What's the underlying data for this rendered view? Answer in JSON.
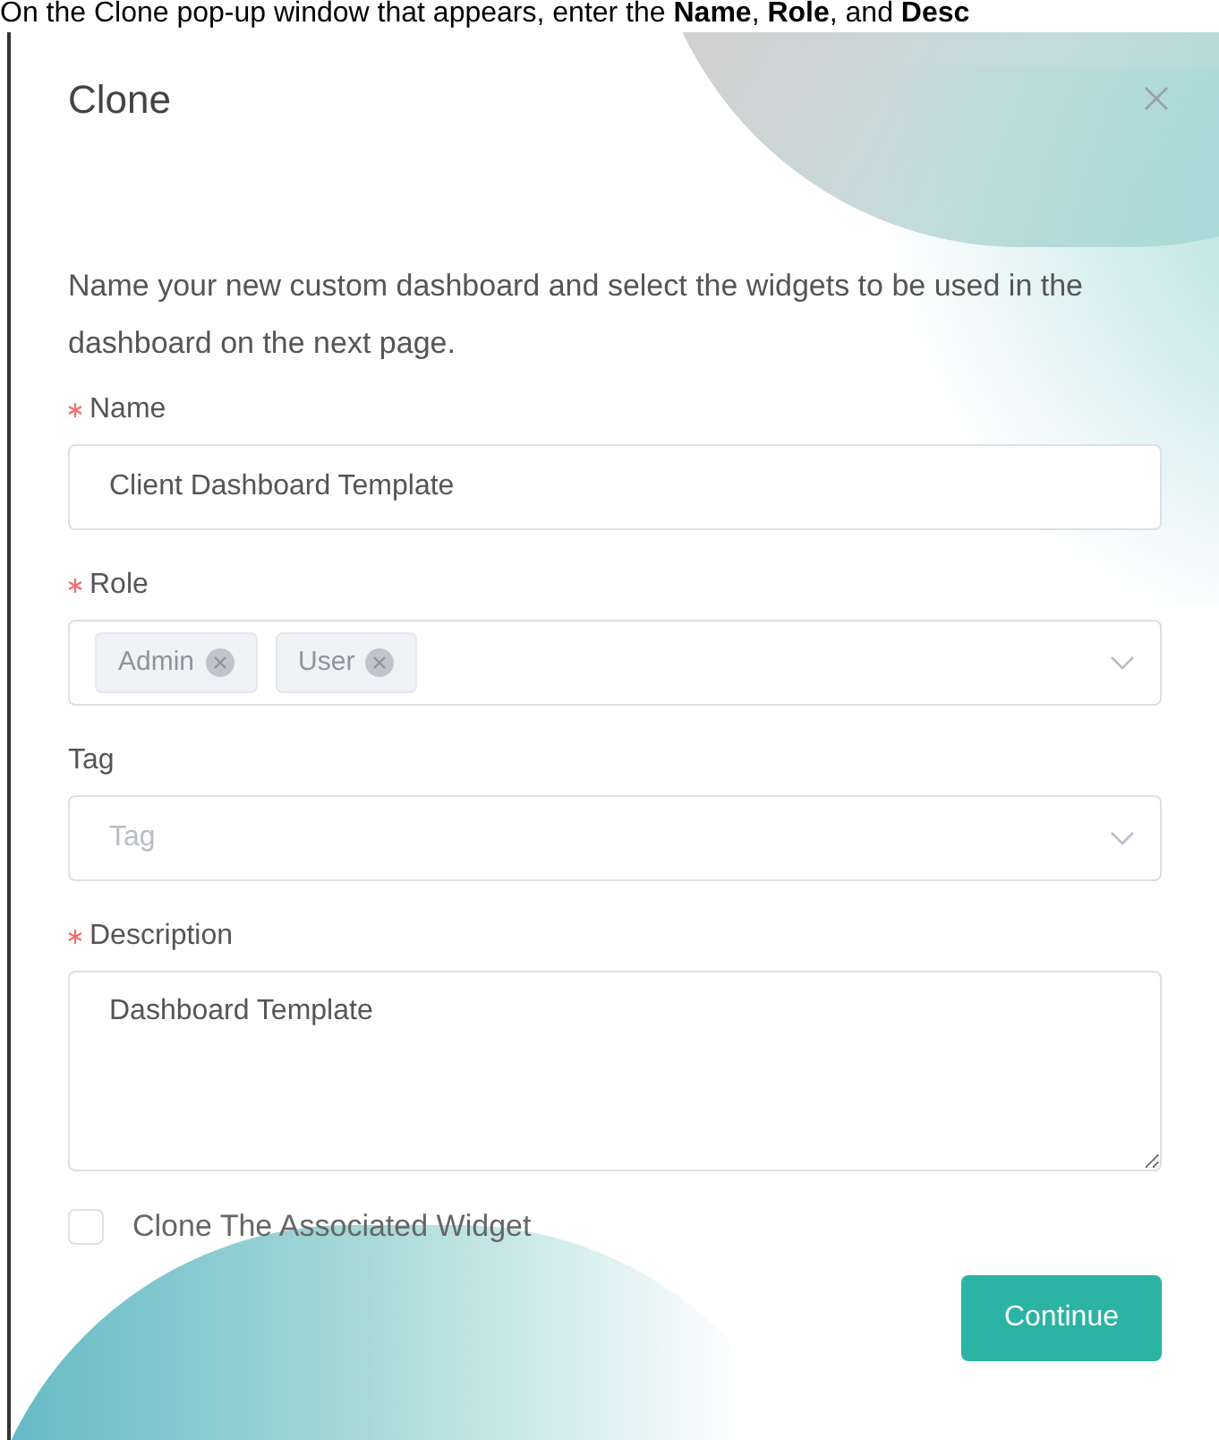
{
  "caption": "On the Clone pop-up window that appears, enter the **Name**, **Role**, and **Desc**",
  "dialog": {
    "title": "Clone",
    "intro": "Name your new custom dashboard and select the widgets to be used in the dashboard on the next page.",
    "fields": [
      {
        "kind": "text",
        "label": "Name",
        "required": true,
        "value": "Client Dashboard Template"
      },
      {
        "kind": "tags",
        "label": "Role",
        "required": true,
        "tags": [
          "Admin",
          "User"
        ]
      },
      {
        "kind": "select",
        "label": "Tag",
        "required": false,
        "placeholder": "Tag"
      },
      {
        "kind": "textarea",
        "label": "Description",
        "required": true,
        "value": "Dashboard Template"
      }
    ],
    "checkbox": {
      "label": "Clone The Associated Widget",
      "checked": false
    },
    "button": "Continue"
  }
}
